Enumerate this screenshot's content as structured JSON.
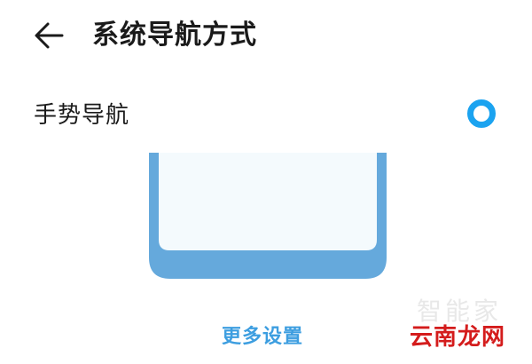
{
  "header": {
    "title": "系统导航方式",
    "back_icon": "arrow-left-icon"
  },
  "option": {
    "label": "手势导航",
    "selected": true
  },
  "colors": {
    "accent": "#1ba3f0",
    "link": "#3d9ee0",
    "phone_frame": "#65a9dc",
    "phone_screen": "#f4fafd",
    "watermark": "#d41c1c"
  },
  "more_settings": "更多设置",
  "watermark": {
    "faint": "智能家",
    "brand": "云南龙网"
  }
}
